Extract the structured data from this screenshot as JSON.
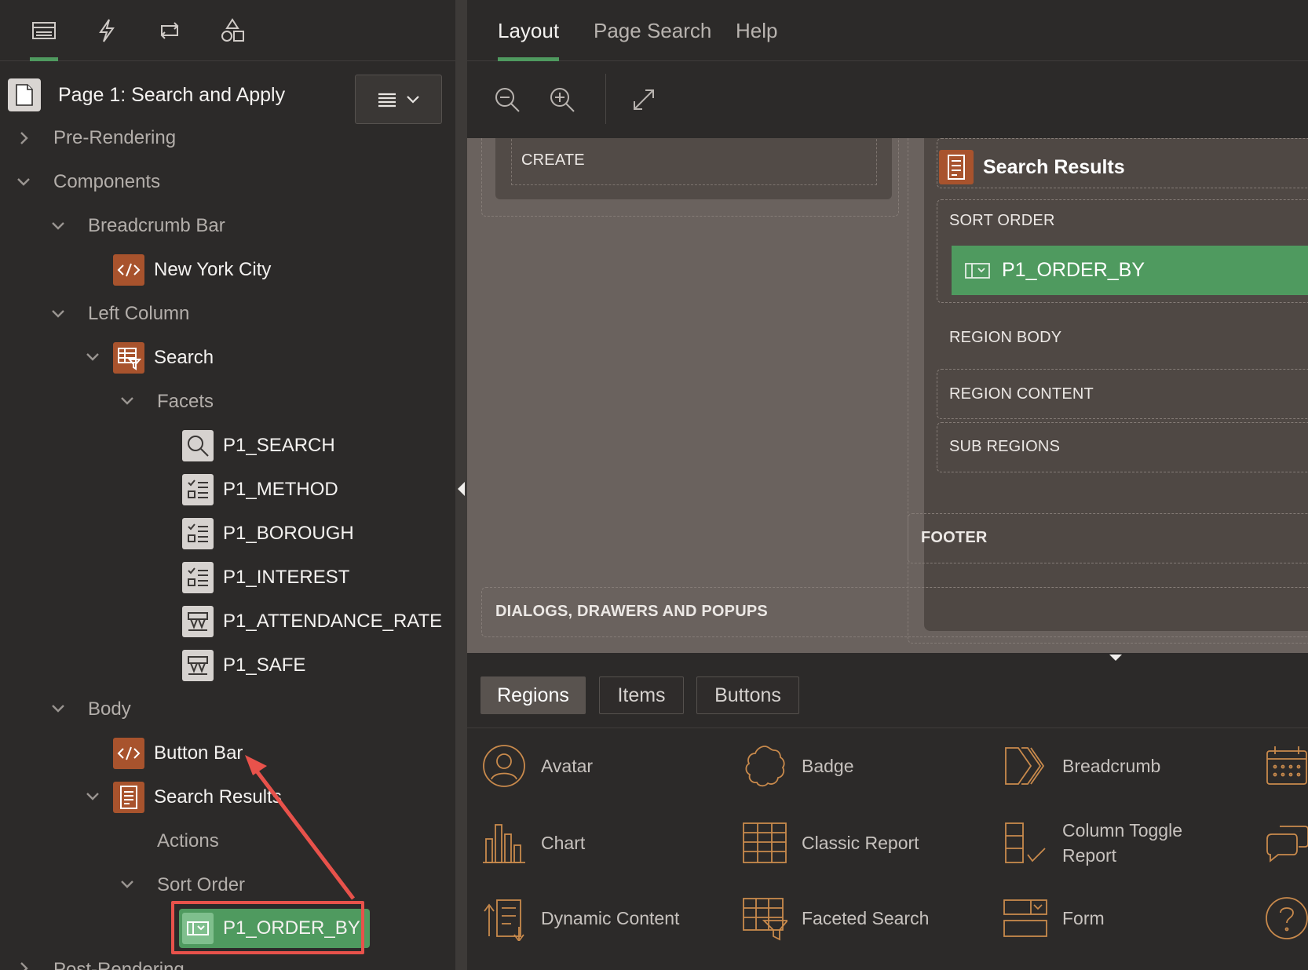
{
  "left_tabs": [
    {
      "icon": "rendering-tree-icon"
    },
    {
      "icon": "dynamic-actions-icon"
    },
    {
      "icon": "processing-icon"
    },
    {
      "icon": "shared-components-icon"
    }
  ],
  "page": {
    "title": "Page 1: Search and Apply"
  },
  "tree": {
    "pre_rendering": "Pre-Rendering",
    "components": "Components",
    "breadcrumb_bar": "Breadcrumb Bar",
    "new_york_city": "New York City",
    "left_column": "Left Column",
    "search": "Search",
    "facets": "Facets",
    "p1_search": "P1_SEARCH",
    "p1_method": "P1_METHOD",
    "p1_borough": "P1_BOROUGH",
    "p1_interest": "P1_INTEREST",
    "p1_attendance_rate": "P1_ATTENDANCE_RATE",
    "p1_safe": "P1_SAFE",
    "body": "Body",
    "button_bar": "Button Bar",
    "search_results": "Search Results",
    "actions": "Actions",
    "sort_order": "Sort Order",
    "p1_order_by": "P1_ORDER_BY",
    "post_rendering": "Post-Rendering"
  },
  "right_tabs": [
    "Layout",
    "Page Search",
    "Help"
  ],
  "canvas": {
    "create": "CREATE",
    "search_results_title": "Search Results",
    "sort_order": "SORT ORDER",
    "order_item": "P1_ORDER_BY",
    "region_body": "REGION BODY",
    "region_content": "REGION CONTENT",
    "sub_regions": "SUB REGIONS",
    "footer": "FOOTER",
    "dialogs": "DIALOGS, DRAWERS AND POPUPS"
  },
  "gallery_tabs": [
    "Regions",
    "Items",
    "Buttons"
  ],
  "gallery": {
    "avatar": "Avatar",
    "badge": "Badge",
    "breadcrumb": "Breadcrumb",
    "chart": "Chart",
    "classic_report": "Classic Report",
    "column_toggle_report_1": "Column Toggle",
    "column_toggle_report_2": "Report",
    "dynamic_content": "Dynamic Content",
    "faceted_search": "Faceted Search",
    "form": "Form"
  },
  "colors": {
    "selected": "#4f9a5f",
    "accent_orange": "#a8532d",
    "highlight_red": "#e8524b"
  }
}
